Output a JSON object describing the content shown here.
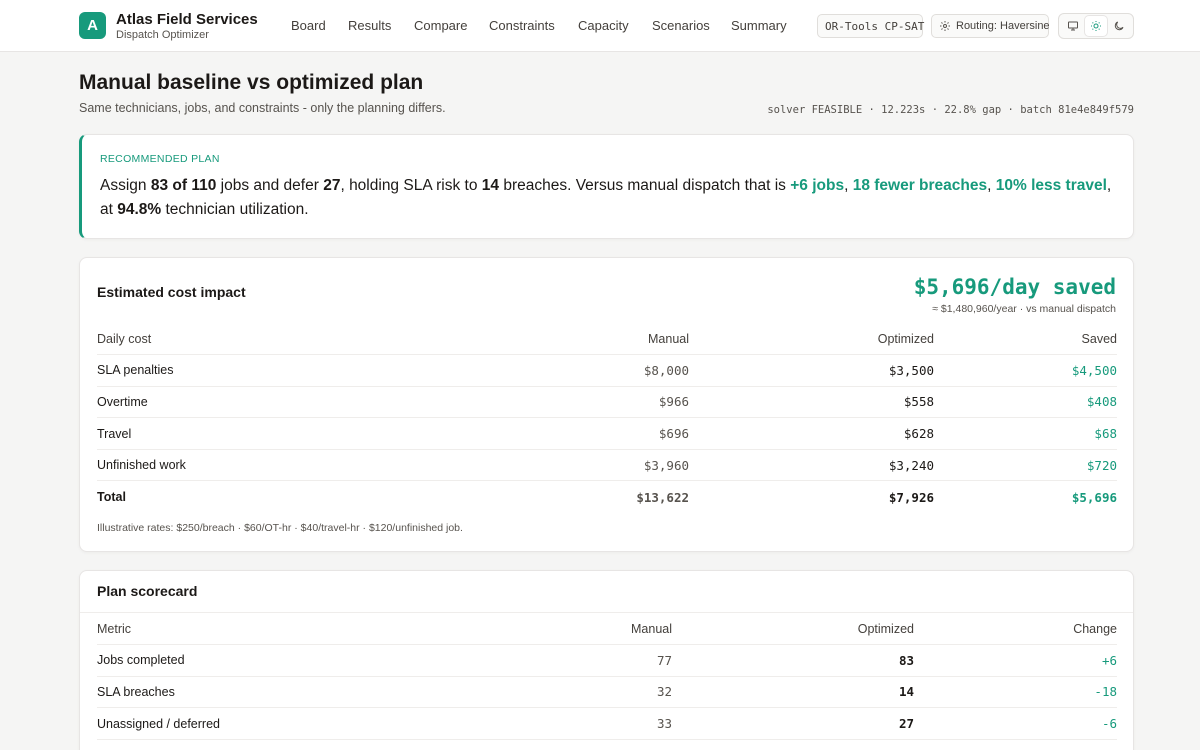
{
  "brand": {
    "logo_letter": "A",
    "title": "Atlas Field Services",
    "subtitle": "Dispatch Optimizer",
    "accent": "#179a7c"
  },
  "nav": [
    "Board",
    "Results",
    "Compare",
    "Constraints",
    "Capacity",
    "Scenarios",
    "Summary"
  ],
  "toolbar": {
    "solver_chip": "OR-Tools CP-SAT",
    "routing_chip": "Routing: Haversine",
    "routing_icon": "gear-icon",
    "modes": [
      "monitor-icon",
      "sun-icon",
      "moon-icon"
    ],
    "active_mode": "sun-icon"
  },
  "header": {
    "title": "Manual baseline vs optimized plan",
    "subtitle": "Same technicians, jobs, and constraints - only the planning differs.",
    "meta": "solver FEASIBLE · 12.223s · 22.8% gap · batch 81e4e849f579"
  },
  "recommended": {
    "label": "RECOMMENDED PLAN",
    "t1": "Assign ",
    "assigned": "83 of 110",
    "t2": " jobs and defer ",
    "deferred": "27",
    "t3": ", holding SLA risk to ",
    "breaches": "14",
    "t4": " breaches. Versus manual dispatch that is ",
    "jobs_delta": "+6 jobs",
    "sep1": ", ",
    "breach_delta": "18 fewer breaches",
    "sep2": ", ",
    "travel_delta": "10% less travel",
    "t5": ", at ",
    "utilization": "94.8%",
    "t6": " technician utilization."
  },
  "cost": {
    "title": "Estimated cost impact",
    "saved_big": "$5,696/day saved",
    "saved_small": "≈ $1,480,960/year · vs manual dispatch",
    "headers": [
      "Daily cost",
      "Manual",
      "Optimized",
      "Saved"
    ],
    "rows": [
      {
        "label": "SLA penalties",
        "manual": "$8,000",
        "optimized": "$3,500",
        "saved": "$4,500"
      },
      {
        "label": "Overtime",
        "manual": "$966",
        "optimized": "$558",
        "saved": "$408"
      },
      {
        "label": "Travel",
        "manual": "$696",
        "optimized": "$628",
        "saved": "$68"
      },
      {
        "label": "Unfinished work",
        "manual": "$3,960",
        "optimized": "$3,240",
        "saved": "$720"
      },
      {
        "label": "Total",
        "manual": "$13,622",
        "optimized": "$7,926",
        "saved": "$5,696"
      }
    ],
    "footnote": "Illustrative rates: $250/breach · $60/OT-hr · $40/travel-hr · $120/unfinished job."
  },
  "scorecard": {
    "title": "Plan scorecard",
    "headers": [
      "Metric",
      "Manual",
      "Optimized",
      "Change"
    ],
    "rows": [
      {
        "label": "Jobs completed",
        "manual": "77",
        "optimized": "83",
        "change": "+6"
      },
      {
        "label": "SLA breaches",
        "manual": "32",
        "optimized": "14",
        "change": "-18"
      },
      {
        "label": "Unassigned / deferred",
        "manual": "33",
        "optimized": "27",
        "change": "-6"
      }
    ]
  }
}
